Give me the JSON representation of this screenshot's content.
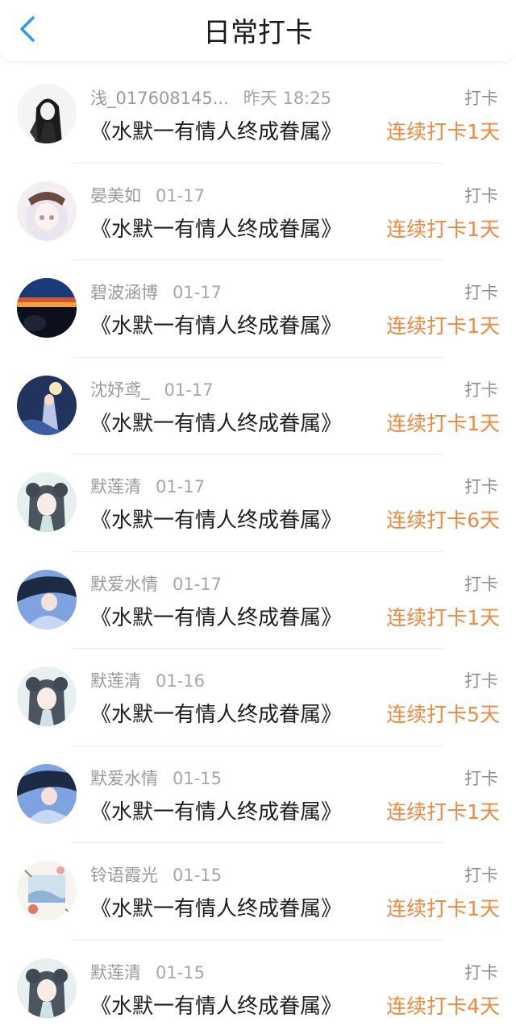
{
  "header": {
    "title": "日常打卡",
    "back_icon": "chevron-left-icon"
  },
  "colors": {
    "accent_blue": "#2c9cf0",
    "streak_orange": "#f0883e",
    "meta_gray": "#9a9a9a",
    "title_dark": "#1f1f1f"
  },
  "entries": [
    {
      "username": "浅_017608145...",
      "time": "昨天 18:25",
      "action": "打卡",
      "book": "《水默一有情人终成眷属》",
      "streak": "连续打卡1天"
    },
    {
      "username": "晏美如",
      "time": "01-17",
      "action": "打卡",
      "book": "《水默一有情人终成眷属》",
      "streak": "连续打卡1天"
    },
    {
      "username": "碧波涵博",
      "time": "01-17",
      "action": "打卡",
      "book": "《水默一有情人终成眷属》",
      "streak": "连续打卡1天"
    },
    {
      "username": "沈妤鸢_",
      "time": "01-17",
      "action": "打卡",
      "book": "《水默一有情人终成眷属》",
      "streak": "连续打卡1天"
    },
    {
      "username": "默莲清",
      "time": "01-17",
      "action": "打卡",
      "book": "《水默一有情人终成眷属》",
      "streak": "连续打卡6天"
    },
    {
      "username": "默爱水情",
      "time": "01-17",
      "action": "打卡",
      "book": "《水默一有情人终成眷属》",
      "streak": "连续打卡1天"
    },
    {
      "username": "默莲清",
      "time": "01-16",
      "action": "打卡",
      "book": "《水默一有情人终成眷属》",
      "streak": "连续打卡5天"
    },
    {
      "username": "默爱水情",
      "time": "01-15",
      "action": "打卡",
      "book": "《水默一有情人终成眷属》",
      "streak": "连续打卡1天"
    },
    {
      "username": "铃语霞光",
      "time": "01-15",
      "action": "打卡",
      "book": "《水默一有情人终成眷属》",
      "streak": "连续打卡1天"
    },
    {
      "username": "默莲清",
      "time": "01-15",
      "action": "打卡",
      "book": "《水默一有情人终成眷属》",
      "streak": "连续打卡4天"
    }
  ]
}
